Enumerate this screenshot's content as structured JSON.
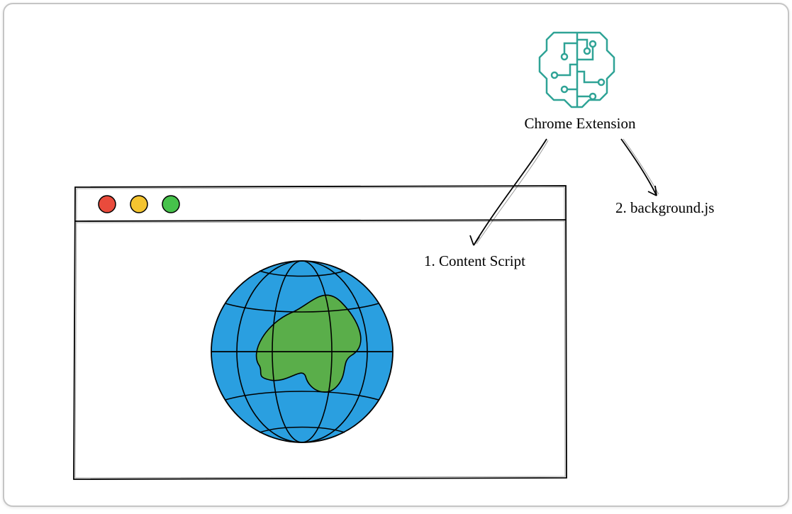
{
  "diagram": {
    "extension_label": "Chrome Extension",
    "content_script_label": "1. Content Script",
    "background_label": "2. background.js"
  },
  "colors": {
    "brain_stroke": "#2fa396",
    "globe_fill": "#2a9fe0",
    "land_fill": "#5aae4a",
    "dot_red": "#e94b3c",
    "dot_yellow": "#f4c430",
    "dot_green": "#46c24b"
  }
}
